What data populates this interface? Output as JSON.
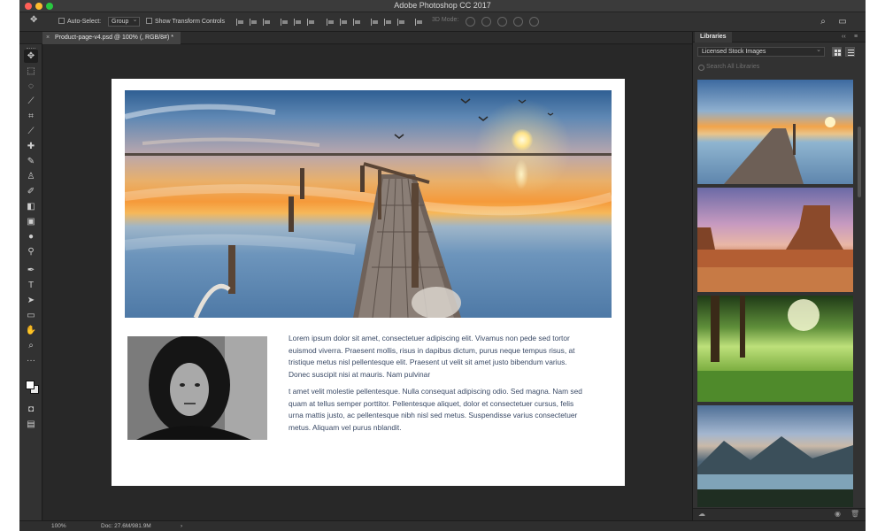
{
  "window": {
    "title": "Adobe Photoshop CC 2017"
  },
  "options_bar": {
    "auto_select_label": "Auto-Select:",
    "auto_select_value": "Group",
    "show_transform_label": "Show Transform Controls",
    "mode_3d_label": "3D Mode:"
  },
  "document": {
    "tab_label": "Product-page-v4.psd @ 100% (, RGB/8#) *"
  },
  "artboard": {
    "paragraph_1": "Lorem ipsum dolor sit amet, consectetuer adipiscing elit. Vivamus non pede sed tortor euismod viverra. Praesent mollis, risus in dapibus dictum, purus neque tempus risus, at tristique metus nisl pellentesque elit. Praesent ut velit sit amet justo bibendum varius. Donec suscipit nisi at mauris. Nam pulvinar",
    "paragraph_2": "t amet velit molestie pellentesque. Nulla consequat adipiscing odio. Sed magna. Nam sed quam at tellus semper porttitor. Pellentesque aliquet, dolor et consectetuer cursus, felis urna mattis justo, ac pellentesque nibh nisl sed metus. Suspendisse varius consectetuer metus. Aliquam vel purus nblandit."
  },
  "libraries_panel": {
    "tab_label": "Libraries",
    "collapse_glyph": "‹‹",
    "menu_glyph": "≡",
    "library_select": "Licensed Stock Images",
    "search_placeholder": "Search All Libraries"
  },
  "status_bar": {
    "zoom": "100%",
    "doc_size": "Doc: 27.6M/981.9M",
    "arrow": "›"
  },
  "colors": {
    "foreground": "#ffffff",
    "background": "#e8e8e8",
    "ui_dark": "#262626",
    "text_blue": "#3a4a66"
  },
  "icons": {
    "tools": [
      "move-tool-icon",
      "marquee-tool-icon",
      "lasso-tool-icon",
      "magic-wand-icon",
      "crop-tool-icon",
      "eyedropper-icon",
      "healing-brush-icon",
      "brush-tool-icon",
      "clone-stamp-icon",
      "history-brush-icon",
      "eraser-icon",
      "gradient-tool-icon",
      "blur-tool-icon",
      "dodge-tool-icon",
      "pen-tool-icon",
      "type-tool-icon",
      "path-selection-icon",
      "rectangle-tool-icon",
      "hand-tool-icon",
      "zoom-tool-icon",
      "more-tools-icon"
    ]
  }
}
